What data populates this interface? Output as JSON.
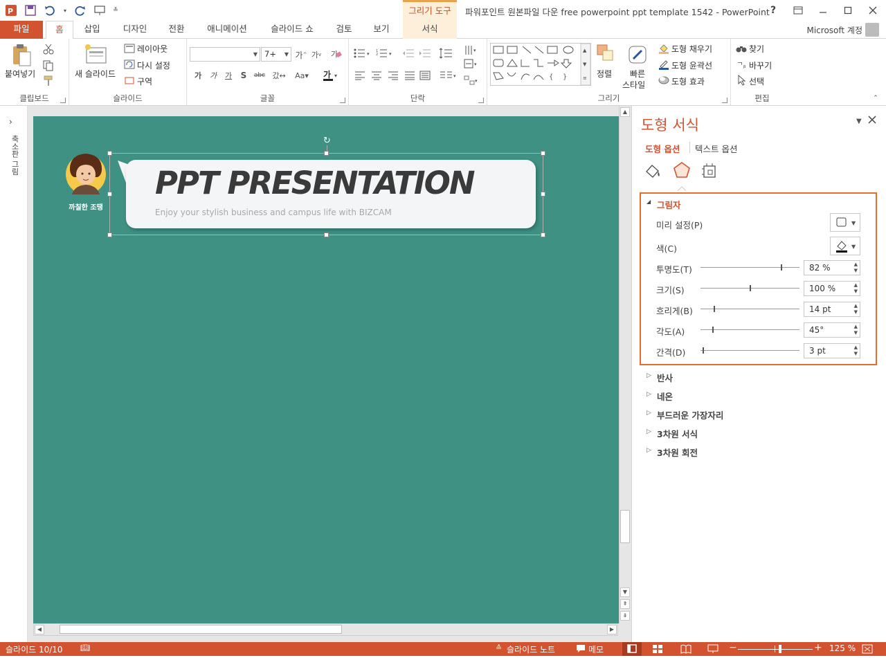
{
  "window": {
    "title": "파워포인트 원본파일 다운 free powerpoint ppt template 1542 - PowerPoint",
    "context_header": "그리기 도구",
    "controls": {
      "help": "?",
      "ribbon_display": "ribbon-display-icon",
      "minimize": "minimize-icon",
      "maximize": "maximize-icon",
      "close": "close-icon"
    }
  },
  "tabs": [
    {
      "label": "파일"
    },
    {
      "label": "홈"
    },
    {
      "label": "삽입"
    },
    {
      "label": "디자인"
    },
    {
      "label": "전환"
    },
    {
      "label": "애니메이션"
    },
    {
      "label": "슬라이드 쇼"
    },
    {
      "label": "검토"
    },
    {
      "label": "보기"
    },
    {
      "label": "서식"
    }
  ],
  "account": "Microsoft 계정",
  "ribbon": {
    "clipboard": {
      "label": "클립보드",
      "paste": "붙여넣기"
    },
    "slides": {
      "label": "슬라이드",
      "new_slide": "새 슬라이드",
      "layout": "레이아웃",
      "reset": "다시 설정",
      "section": "구역"
    },
    "font": {
      "label": "글꼴",
      "font_name": "",
      "font_size": "7+"
    },
    "paragraph": {
      "label": "단락"
    },
    "drawing": {
      "label": "그리기",
      "arrange": "정렬",
      "quick_styles_1": "빠른",
      "quick_styles_2": "스타일",
      "fill": "도형 채우기",
      "outline": "도형 윤곽선",
      "effects": "도형 효과"
    },
    "editing": {
      "label": "편집",
      "find": "찾기",
      "replace": "바꾸기",
      "select": "선택"
    }
  },
  "left_strip": {
    "label": "축소판 그림"
  },
  "slide": {
    "person_caption": "까칠한 조땡",
    "bubble_title": "PPT PRESENTATION",
    "bubble_subtitle": "Enjoy your stylish business and campus life with BIZCAM"
  },
  "format_panel": {
    "title": "도형 서식",
    "tab_shape": "도형 옵션",
    "tab_text": "텍스트 옵션",
    "shadow": {
      "header": "그림자",
      "preset_label": "미리 설정(P)",
      "color_label": "색(C)",
      "transparency_label": "투명도(T)",
      "transparency_value": "82 %",
      "transparency_level": 0.82,
      "size_label": "크기(S)",
      "size_value": "100 %",
      "size_level": 0.5,
      "blur_label": "흐리게(B)",
      "blur_value": "14 pt",
      "blur_level": 0.14,
      "angle_label": "각도(A)",
      "angle_value": "45°",
      "angle_level": 0.125,
      "distance_label": "간격(D)",
      "distance_value": "3 pt",
      "distance_level": 0.03
    },
    "sections": [
      "반사",
      "네온",
      "부드러운 가장자리",
      "3차원 서식",
      "3차원 회전"
    ]
  },
  "statusbar": {
    "slide_info": "슬라이드 10/10",
    "notes": "슬라이드 노트",
    "comments": "메모",
    "zoom": "125 %",
    "zoom_level": 0.56
  },
  "colors": {
    "accent": "#d35230",
    "slide_bg": "#3f9183",
    "highlight": "#e96d2a"
  }
}
